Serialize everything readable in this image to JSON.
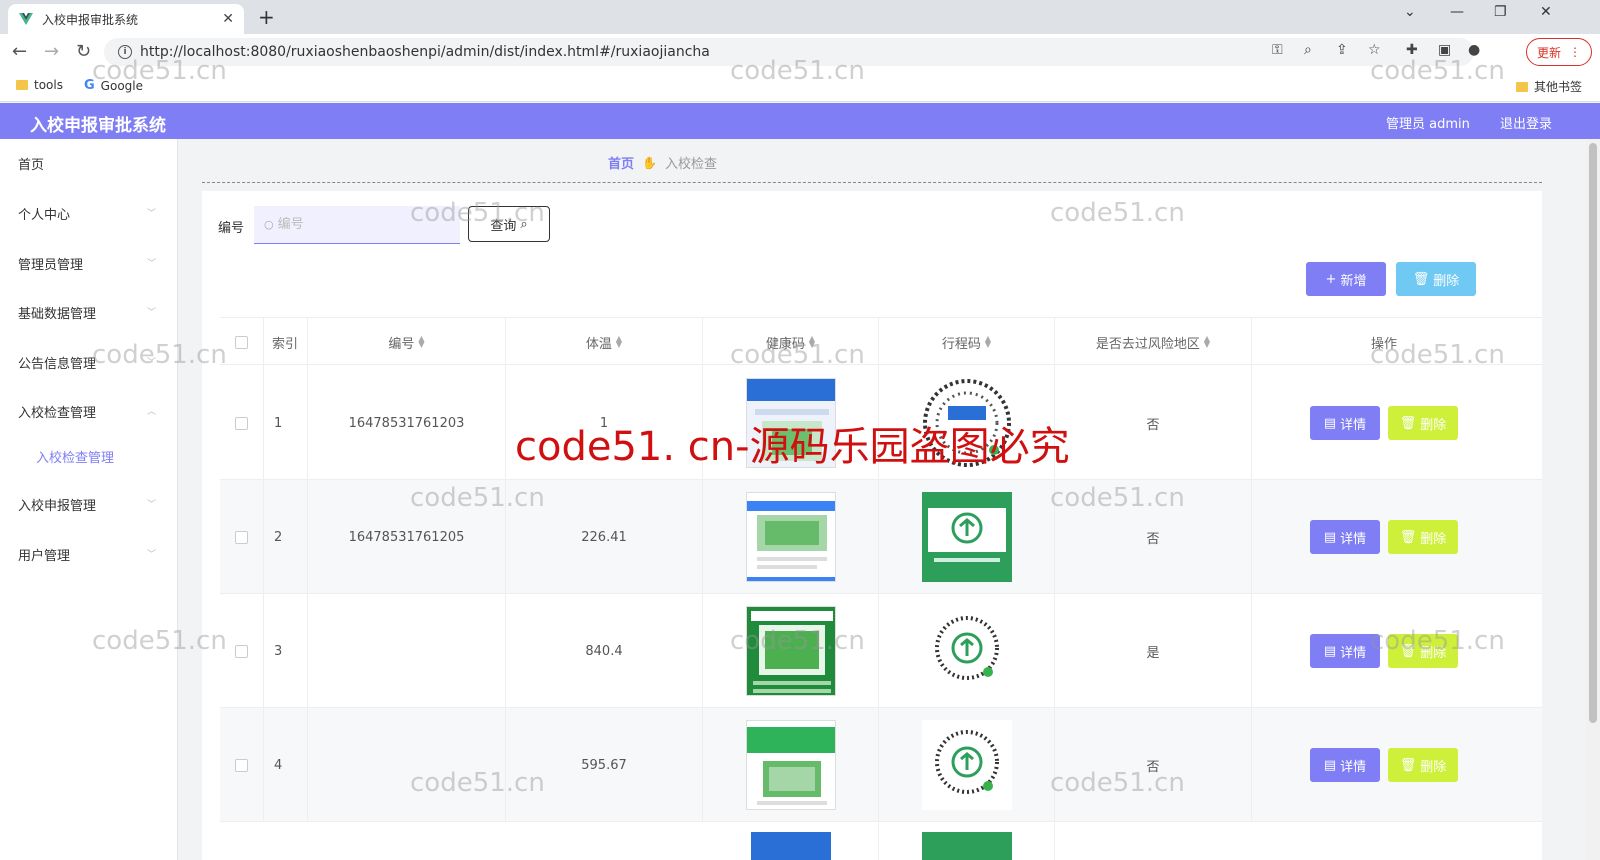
{
  "browser": {
    "tab_title": "入校申报审批系统",
    "url": "http://localhost:8080/ruxiaoshenbaoshenpi/admin/dist/index.html#/ruxiaojiancha",
    "update_label": "更新",
    "bookmarks": [
      "tools",
      "Google"
    ],
    "other_bookmarks": "其他书签"
  },
  "header": {
    "title": "入校申报审批系统",
    "user": "管理员 admin",
    "logout": "退出登录"
  },
  "sidebar": {
    "items": [
      {
        "label": "首页"
      },
      {
        "label": "个人中心"
      },
      {
        "label": "管理员管理"
      },
      {
        "label": "基础数据管理"
      },
      {
        "label": "公告信息管理"
      },
      {
        "label": "入校检查管理"
      },
      {
        "label": "入校申报管理"
      },
      {
        "label": "用户管理"
      }
    ],
    "sub_item": "入校检查管理"
  },
  "breadcrumb": {
    "home": "首页",
    "current": "入校检查"
  },
  "search": {
    "label": "编号",
    "placeholder": "编号",
    "button": "查询"
  },
  "actions": {
    "add": "新增",
    "delete": "删除"
  },
  "table": {
    "headers": [
      "索引",
      "编号",
      "体温",
      "健康码",
      "行程码",
      "是否去过风险地区",
      "操作"
    ],
    "rows": [
      {
        "index": "1",
        "code": "16478531761203",
        "temp": "1",
        "risk": "否"
      },
      {
        "index": "2",
        "code": "16478531761205",
        "temp": "226.41",
        "risk": "否"
      },
      {
        "index": "3",
        "code": "",
        "temp": "840.4",
        "risk": "是"
      },
      {
        "index": "4",
        "code": "",
        "temp": "595.67",
        "risk": "否"
      }
    ],
    "detail_label": "详情",
    "delete_label": "删除"
  },
  "watermark": {
    "text": "code51.cn",
    "red_text": "code51. cn-源码乐园盗图必究"
  },
  "colors": {
    "primary": "#7f7ef5",
    "info": "#6fc9f2",
    "warning": "#cff03a"
  }
}
